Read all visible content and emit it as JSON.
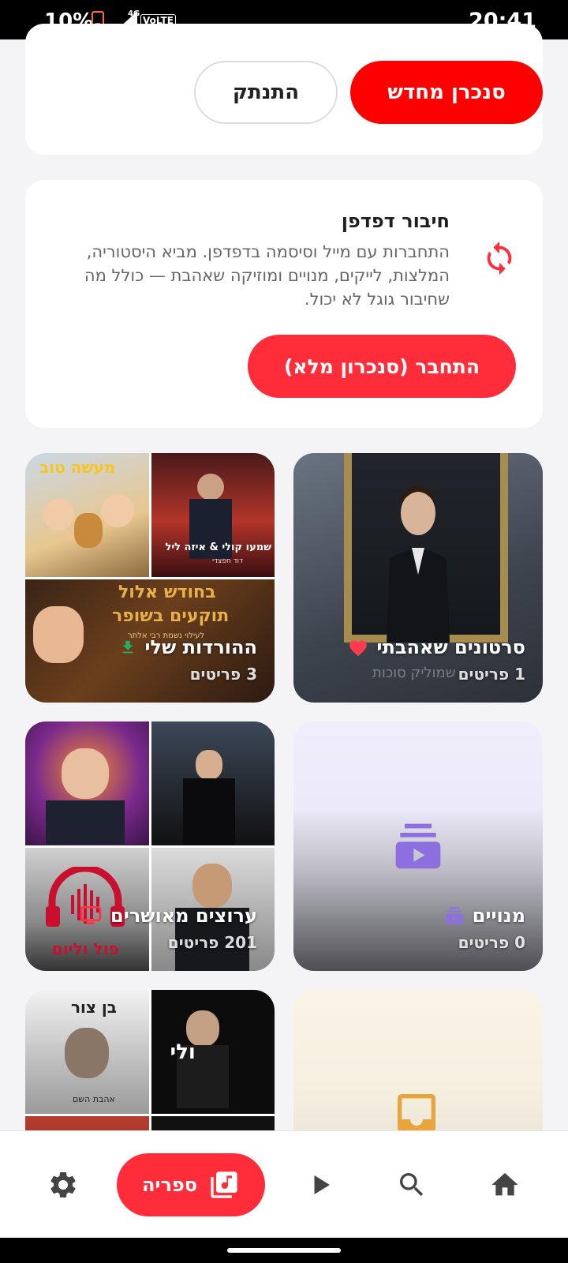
{
  "status_bar": {
    "battery": "10%",
    "network": "4G",
    "volte": "VoLTE",
    "time": "20:41"
  },
  "account": {
    "resync_label": "סנכרן מחדש",
    "disconnect_label": "התנתק"
  },
  "browser_connect": {
    "title": "חיבור דפדפן",
    "description": "התחברות עם מייל וסיסמה בדפדפן. מביא היסטוריה, המלצות, לייקים, מנויים ומוזיקה שאהבת — כולל מה שחיבור גוגל לא יכול.",
    "connect_label": "התחבר (סנכרון מלא)"
  },
  "tiles": {
    "liked": {
      "name": "סרטונים שאהבתי",
      "count": "1 פריטים",
      "thumb_text": "שמוליק סוכות"
    },
    "downloads": {
      "name": "ההורדות שלי",
      "count": "3 פריטים",
      "thumb_texts": [
        "מעשה טוב",
        "שמעו קולי & איזה ליל",
        "דוד חפצדי",
        "בחודש אלול",
        "תוקעים בשופר",
        "לעילוי נשמת רבי אלתר"
      ]
    },
    "subscriptions": {
      "name": "מנויים",
      "count": "0 פריטים"
    },
    "channels": {
      "name": "ערוצים מאושרים",
      "count": "201 פריטים",
      "thumb_text": "פול וליום"
    },
    "playlists": {
      "thumb_texts": [
        "בן צור",
        "אהבת השם",
        "ולי"
      ]
    }
  },
  "bottom_nav": {
    "library_label": "ספריה"
  },
  "colors": {
    "accent": "#ff2d3a",
    "sync_red": "#ff0000",
    "heart": "#ff3b4f",
    "download": "#27ae60",
    "tv": "#ff3344",
    "sub_purple": "#8e6fe0"
  }
}
